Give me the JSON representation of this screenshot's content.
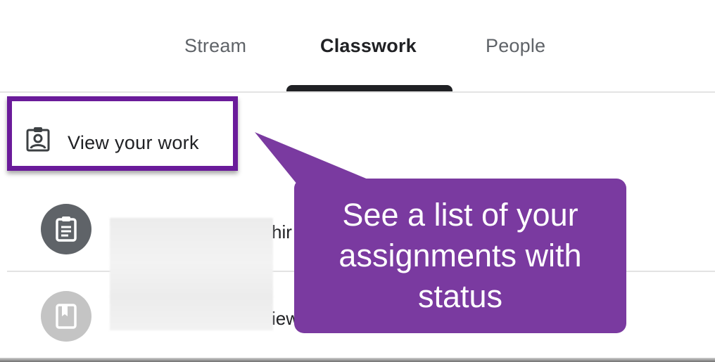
{
  "tabs": [
    {
      "label": "Stream",
      "active": false
    },
    {
      "label": "Classwork",
      "active": true
    },
    {
      "label": "People",
      "active": false
    }
  ],
  "view_work": {
    "label": "View your work",
    "icon": "assignment-ind-icon"
  },
  "items": [
    {
      "icon": "assignment-icon",
      "title_fragment": "hir"
    },
    {
      "icon": "material-icon",
      "title_fragment": "iew"
    }
  ],
  "callout": {
    "text": "See a list of your assignments with status"
  },
  "colors": {
    "callout": "#7a3aa0",
    "highlight_border": "#6a1b9a",
    "active_tab": "#202124",
    "inactive_tab": "#5f6368"
  }
}
